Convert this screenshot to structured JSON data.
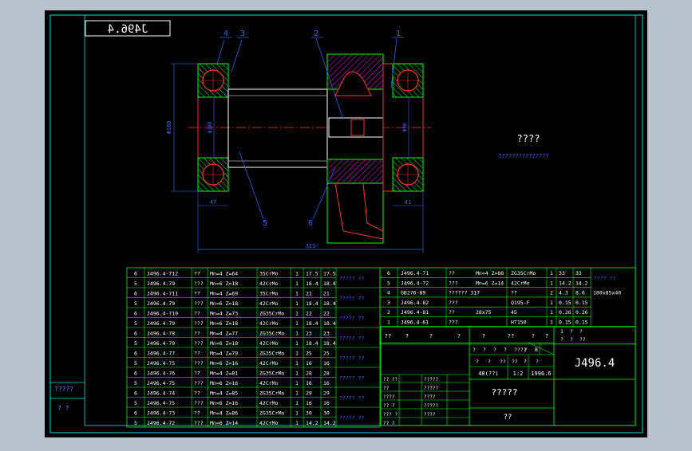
{
  "colors": {
    "background": "#000000",
    "frame": "#00e0e0",
    "table_line": "#00ff00",
    "text": "#ffffff",
    "part_red": "#ff3030",
    "part_green": "#00ff00",
    "hatch": "#ff00ff",
    "dim_blue": "#3366ff",
    "center": "#ff3030"
  },
  "title_stamp": "J496.4",
  "balloons": [
    "4",
    "3",
    "2",
    "1",
    "5",
    "6"
  ],
  "dims": {
    "overall_length": "323",
    "left_width": "47",
    "right_width": "41",
    "height_left": "Φ180",
    "height_mid": "Φ100",
    "height_right": "Φ90"
  },
  "notes": {
    "heading": "????",
    "body": "???????????????"
  },
  "left_table": {
    "rows": [
      [
        "6",
        "J496.4-712",
        "??",
        "Mn=4 Z=64",
        "35CrMo",
        "1",
        "17.5",
        "17.5"
      ],
      [
        "5",
        "J496.4-79",
        "???",
        "Mn=6 Z=18",
        "42CrMo",
        "1",
        "18.4",
        "18.4"
      ],
      [
        "6",
        "J496.4-711",
        "??",
        "Mn=4 Z=69",
        "35CrMo",
        "1",
        "21",
        "21"
      ],
      [
        "5",
        "J496.4-79",
        "???",
        "Mn=6 Z=18",
        "42CrMo",
        "1",
        "18.4",
        "18.4"
      ],
      [
        "6",
        "J496.4-710",
        "??",
        "Mn=4 Z=73",
        "ZG35CrMo",
        "1",
        "22",
        "22"
      ],
      [
        "5",
        "J496.4-79",
        "???",
        "Mn=6 Z=18",
        "42CrMo",
        "1",
        "18.4",
        "18.4"
      ],
      [
        "6",
        "J496.4-78",
        "??",
        "Mn=4 Z=77",
        "ZG35CrMo",
        "1",
        "23",
        "23"
      ],
      [
        "5",
        "J496.4-79",
        "???",
        "Mn=6 Z=18",
        "42CrMo",
        "1",
        "18.4",
        "18.4"
      ],
      [
        "6",
        "J496.4-77",
        "??",
        "Mn=4 Z=79",
        "ZG35CrMo",
        "1",
        "25",
        "25"
      ],
      [
        "5",
        "J496.4-75",
        "???",
        "Mn=6 Z=16",
        "42CrMo",
        "1",
        "16",
        "16"
      ],
      [
        "6",
        "J496.4-76",
        "??",
        "Mn=4 Z=81",
        "ZG35CrMo",
        "1",
        "28",
        "28"
      ],
      [
        "5",
        "J496.4-75",
        "???",
        "Mn=6 Z=16",
        "42CrMo",
        "1",
        "16",
        "16"
      ],
      [
        "6",
        "J496.4-74",
        "??",
        "Mn=4 Z=85",
        "ZG35CrMo",
        "1",
        "29",
        "29"
      ],
      [
        "5",
        "J496.4-75",
        "???",
        "Mn=6 Z=16",
        "42CrMo",
        "1",
        "16",
        "16"
      ],
      [
        "6",
        "J496.4-73",
        "??",
        "Mn=4 Z=86",
        "ZG35CrMo",
        "1",
        "30",
        "30"
      ],
      [
        "5",
        "J496.4-72",
        "???",
        "Mn=6 Z=14",
        "42CrMo",
        "1",
        "14.2",
        "14.2"
      ]
    ],
    "group_labels": [
      "????? ??",
      "????? ??",
      "????? ??",
      "????? ??",
      "????? ??",
      "????? ??",
      "????? ??",
      "????? ??"
    ]
  },
  "right_table": {
    "rows": [
      [
        "6",
        "J496.4-71",
        "??",
        "Mn=4 Z=88",
        "ZG35CrMo",
        "1",
        "33",
        "33"
      ],
      [
        "5",
        "J496.4-72",
        "???",
        "Mn=6 Z=14",
        "42CrMo",
        "1",
        "14.2",
        "14.2"
      ],
      [
        "4",
        "GB276-89",
        "?????? 317",
        "",
        "??",
        "2",
        "4.3",
        "8.6"
      ],
      [
        "3",
        "J496.4-82",
        "???",
        "",
        "Q195-F",
        "1",
        "0.15",
        "0.15"
      ],
      [
        "2",
        "J496.4-81",
        "??",
        "28x75",
        "45",
        "1",
        "0.26",
        "0.26"
      ],
      [
        "1",
        "J496.4-61",
        "???",
        "",
        "HT150",
        "1",
        "0.15",
        "0.15"
      ]
    ],
    "group_label": "????  ??",
    "extra": "180x85x40",
    "header_cells": [
      "??",
      "?",
      "?",
      "?",
      "?",
      "??",
      "?",
      "?"
    ],
    "small_a": [
      "1",
      "?",
      "?"
    ],
    "small_b": [
      "?",
      "?",
      "??"
    ]
  },
  "title_block": {
    "drawing_no": "J496.4",
    "name": "?????",
    "org": "??",
    "scale": "40(??)",
    "sheet": "1:2",
    "date": "1996.6",
    "cells_top": [
      "?",
      "?",
      "?",
      "?",
      "????",
      "/",
      "B"
    ],
    "cells_mid": [
      "?",
      "?",
      "??",
      "??",
      "?",
      "?"
    ],
    "sig_labels": [
      "?? ??",
      "??",
      "????",
      "?? ?",
      "??? ?",
      "?? ?"
    ],
    "sig_names": [
      "?????",
      "?????",
      "????",
      "?????",
      "????",
      ""
    ],
    "mini_labels": [
      "?? ??",
      "?? ?",
      "?? ?",
      "?? ?",
      "??? ?",
      "?? ?"
    ]
  },
  "left_margin": {
    "label1": "?????",
    "label2": "?   ?"
  }
}
